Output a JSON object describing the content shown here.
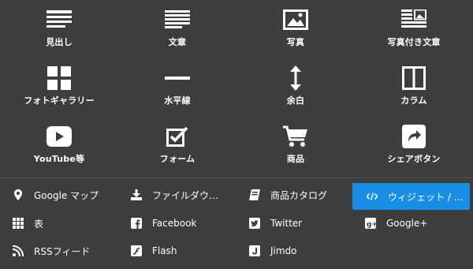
{
  "tiles": [
    {
      "label": "見出し",
      "icon": "heading-icon"
    },
    {
      "label": "文章",
      "icon": "text-icon"
    },
    {
      "label": "写真",
      "icon": "photo-icon"
    },
    {
      "label": "写真付き文章",
      "icon": "photo-text-icon"
    },
    {
      "label": "フォトギャラリー",
      "icon": "gallery-icon"
    },
    {
      "label": "水平線",
      "icon": "horizontal-line-icon"
    },
    {
      "label": "余白",
      "icon": "spacer-icon"
    },
    {
      "label": "カラム",
      "icon": "columns-icon"
    },
    {
      "label": "YouTube等",
      "icon": "video-icon"
    },
    {
      "label": "フォーム",
      "icon": "form-icon"
    },
    {
      "label": "商品",
      "icon": "cart-icon"
    },
    {
      "label": "シェアボタン",
      "icon": "share-icon"
    }
  ],
  "list_items": [
    {
      "label": "Google マップ",
      "icon": "map-pin-icon"
    },
    {
      "label": "ファイルダウ…",
      "icon": "download-icon"
    },
    {
      "label": "商品カタログ",
      "icon": "catalog-icon"
    },
    {
      "label": "ウィジェット / …",
      "icon": "code-icon",
      "active": true
    },
    {
      "label": "表",
      "icon": "table-icon"
    },
    {
      "label": "Facebook",
      "icon": "facebook-icon"
    },
    {
      "label": "Twitter",
      "icon": "twitter-icon"
    },
    {
      "label": "Google+",
      "icon": "google-plus-icon"
    },
    {
      "label": "RSSフィード",
      "icon": "rss-icon"
    },
    {
      "label": "Flash",
      "icon": "flash-icon"
    },
    {
      "label": "Jimdo",
      "icon": "jimdo-icon"
    }
  ],
  "colors": {
    "background": "#3d3d3d",
    "accent": "#1a8ee6",
    "text": "#ffffff"
  }
}
